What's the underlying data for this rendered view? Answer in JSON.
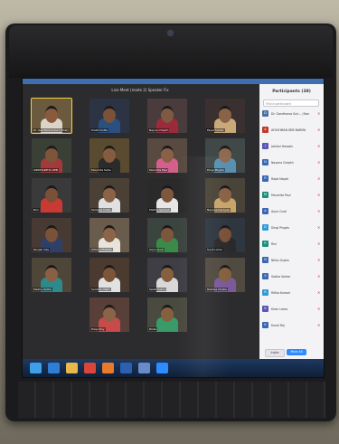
{
  "meeting": {
    "title": "Live Meet (mode 2) Speaker Fix"
  },
  "participants_panel": {
    "header": "Participants (38)",
    "search_placeholder": "Find a participant",
    "rows": [
      {
        "label": "Dr. Gandharva Suri... (Host, me)",
        "initial": "D",
        "color": "#4a6fa5"
      },
      {
        "label": "AYUSHMAN DEB BARMA",
        "initial": "A",
        "color": "#c0392b"
      },
      {
        "label": "Jahidul Hossain",
        "initial": "J",
        "color": "#5a56b8"
      },
      {
        "label": "Nayana Chepth",
        "initial": "N",
        "color": "#3b66b3"
      },
      {
        "label": "Rajat Nayak",
        "initial": "R",
        "color": "#3b66b3"
      },
      {
        "label": "Moumita Paul",
        "initial": "M",
        "color": "#1a8f7a"
      },
      {
        "label": "Arjun Gudi",
        "initial": "A",
        "color": "#3b66b3"
      },
      {
        "label": "Dingi Pingdu",
        "initial": "D",
        "color": "#2e9bd6"
      },
      {
        "label": "Rini",
        "initial": "R",
        "color": "#1a8f7a"
      },
      {
        "label": "Nikku Gupta",
        "initial": "N",
        "color": "#3b66b3"
      },
      {
        "label": "Sobha Sarkar",
        "initial": "S",
        "color": "#3b66b3"
      },
      {
        "label": "Ritika Kumari",
        "initial": "R",
        "color": "#2e9bd6"
      },
      {
        "label": "Kiran Lama",
        "initial": "K",
        "color": "#5a56b8"
      },
      {
        "label": "Kunal Raj",
        "initial": "K",
        "color": "#3b66b3"
      }
    ],
    "invite_label": "Invite",
    "mute_all_label": "Mute All"
  },
  "tiles": [
    {
      "name": "Dr. Gandharva Suri (Host)",
      "bg": "#6c5a3e",
      "skin": "#8a5a3c",
      "shirt": "#d9d3c8",
      "active": true
    },
    {
      "name": "Pratik Dutta",
      "bg": "#2c3342",
      "skin": "#7a5238",
      "shirt": "#2a5080",
      "active": false
    },
    {
      "name": "Nayna Chepth",
      "bg": "#4a3c3c",
      "skin": "#7f5a42",
      "shirt": "#9c2a3a",
      "active": false
    },
    {
      "name": "Payal Sarkar",
      "bg": "#3a3030",
      "skin": "#8a6248",
      "shirt": "#c9a87a",
      "active": false
    },
    {
      "name": "SIDDHARTHA DEB",
      "bg": "#3a4036",
      "skin": "#7c553b",
      "shirt": "#a33a3a",
      "active": false
    },
    {
      "name": "Moumita Saha",
      "bg": "#5a4a30",
      "skin": "#865c40",
      "shirt": "#2b2b2b",
      "active": false
    },
    {
      "name": "Moumita Paul",
      "bg": "#584a40",
      "skin": "#8a6046",
      "shirt": "#d45f8a",
      "active": false
    },
    {
      "name": "Dingi Pingdu",
      "bg": "#404848",
      "skin": "#8e6a50",
      "shirt": "#5a8fb0",
      "active": false
    },
    {
      "name": "Rini",
      "bg": "#3a3a3a",
      "skin": "#7a5036",
      "shirt": "#c83a32",
      "active": false
    },
    {
      "name": "Sampad Dutta",
      "bg": "#4a4036",
      "skin": "#8c6246",
      "shirt": "#e0e0e0",
      "active": false
    },
    {
      "name": "Madhu Sarmah",
      "bg": "#2a2a2a",
      "skin": "#7e583e",
      "shirt": "#e6e6e6",
      "active": false
    },
    {
      "name": "Nayana Kashyap",
      "bg": "#4a4438",
      "skin": "#8a6246",
      "shirt": "#c7a46a",
      "active": false
    },
    {
      "name": "Ranjan Das",
      "bg": "#463a32",
      "skin": "#7a5238",
      "shirt": "#2f3f68",
      "active": false
    },
    {
      "name": "HEMA CHAKMA",
      "bg": "#6a5c4c",
      "skin": "#8c6448",
      "shirt": "#e8e4dc",
      "active": false
    },
    {
      "name": "Arjun Gudi",
      "bg": "#3c4440",
      "skin": "#7e563c",
      "shirt": "#3a8a4a",
      "active": false
    },
    {
      "name": "Sunil Lama",
      "bg": "#2e3640",
      "skin": "#7a5038",
      "shirt": "#2a2a2a",
      "active": false
    },
    {
      "name": "Madhu Dutta",
      "bg": "#4e4638",
      "skin": "#8a6044",
      "shirt": "#2e8a8a",
      "active": false
    },
    {
      "name": "Sambhu Nath",
      "bg": "#4a3a30",
      "skin": "#7c5438",
      "shirt": "#e1e1e1",
      "active": false
    },
    {
      "name": "Swati Sahoo",
      "bg": "#3e3e44",
      "skin": "#86603e",
      "shirt": "#d8d8d8",
      "active": false
    },
    {
      "name": "Rakhee Chetia",
      "bg": "#504a40",
      "skin": "#84603f",
      "shirt": "#7a5a9a",
      "active": false
    },
    {
      "name": "Pooja Roy",
      "bg": "#584038",
      "skin": "#8a6448",
      "shirt": "#c84a4a",
      "active": false
    },
    {
      "name": "Rinku",
      "bg": "#4a4a40",
      "skin": "#84603f",
      "shirt": "#3a9a6a",
      "active": false
    }
  ],
  "taskbar": {
    "icons": [
      {
        "name": "start-icon",
        "color": "#3ea0e8"
      },
      {
        "name": "ie-icon",
        "color": "#2e7fd4"
      },
      {
        "name": "folder-icon",
        "color": "#e8b84a"
      },
      {
        "name": "chrome-icon",
        "color": "#d8463a"
      },
      {
        "name": "media-icon",
        "color": "#e87a2a"
      },
      {
        "name": "word-icon",
        "color": "#2b5fb0"
      },
      {
        "name": "app-icon",
        "color": "#6a8ac8"
      },
      {
        "name": "zoom-icon",
        "color": "#2d8cff"
      }
    ]
  }
}
